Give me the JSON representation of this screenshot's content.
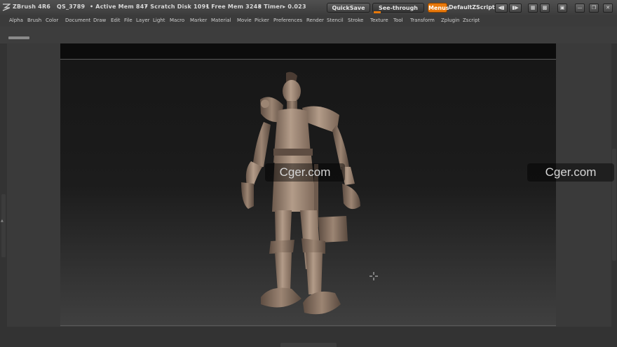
{
  "titlebar": {
    "app_name": "ZBrush 4R6",
    "doc_name": "QS_3789",
    "active_mem": "• Active Mem 847",
    "scratch_disk": "• Scratch Disk 1091",
    "free_mem": "• Free Mem 3248",
    "timer": "• Timer▸ 0.023",
    "quicksave_label": "QuickSave",
    "seethrough_label": "See-through",
    "seethrough_value": "0",
    "menus_label": "Menus",
    "defaultzscript_label": "DefaultZScript"
  },
  "menubar": {
    "items": [
      "Alpha",
      "Brush",
      "Color",
      "Document",
      "Draw",
      "Edit",
      "File",
      "Layer",
      "Light",
      "Macro",
      "Marker",
      "Material",
      "Movie",
      "Picker",
      "Preferences",
      "Render",
      "Stencil",
      "Stroke",
      "Texture",
      "Tool",
      "Transform",
      "Zplugin",
      "Zscript"
    ]
  },
  "watermark": {
    "center_text": "Cger.com",
    "right_text": "Cger.com"
  },
  "colors": {
    "accent": "#e8780a",
    "canvas_top": "#161616",
    "canvas_bottom": "#404040",
    "model_clay": "#a58e7c"
  },
  "viewport": {
    "model_description_icon": "character-sculpt"
  }
}
